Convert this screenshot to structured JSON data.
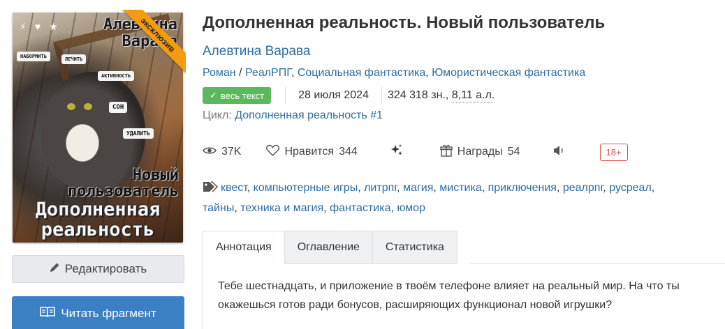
{
  "book": {
    "title": "Дополненная реальность. Новый пользователь",
    "author": "Алевтина Варава",
    "genres": [
      "Роман",
      "РеалРПГ",
      "Социальная фантастика",
      "Юмористическая фантастика"
    ],
    "status_badge": "весь текст",
    "date": "28 июля 2024",
    "size_chars": "324 318 зн.,",
    "size_al": "8,11 а.л.",
    "series_label": "Цикл:",
    "series_link": "Дополненная реальность #1"
  },
  "cover": {
    "author_text": "Алевтина\nВарава",
    "badge": "эксклюзив",
    "subtitle": "Новый\nпользователь",
    "title": "Дополненная\nреальность",
    "chips": [
      "НАБОРМИТЬ",
      "ЛЕЧИТЬ",
      "АКТИВНОСТЬ",
      "СОН",
      "УДАЛИТЬ"
    ]
  },
  "stats": {
    "views": "37K",
    "likes_label": "Нравится",
    "likes": "344",
    "awards_label": "Награды",
    "awards": "54",
    "age_rating": "18+"
  },
  "tags": [
    "квест",
    "компьютерные игры",
    "литрпг",
    "магия",
    "мистика",
    "приключения",
    "реалрпг",
    "русреал",
    "тайны",
    "техника и магия",
    "фантастика",
    "юмор"
  ],
  "tabs": [
    {
      "label": "Аннотация",
      "active": true
    },
    {
      "label": "Оглавление",
      "active": false
    },
    {
      "label": "Статистика",
      "active": false
    }
  ],
  "annotation": "Тебе шестнадцать, и приложение в твоём телефоне влияет на реальный мир. На что ты окажешься готов ради бонусов, расширяющих функционал новой игрушки?",
  "buttons": {
    "edit": "Редактировать",
    "read": "Читать фрагмент"
  },
  "icons": {
    "eye": "eye-icon",
    "heart": "heart-icon",
    "sparkle": "sparkle-icon",
    "gift": "gift-icon",
    "speaker": "speaker-icon",
    "tag": "tag-icon",
    "pencil": "pencil-icon",
    "book": "open-book-icon",
    "check": "check-icon"
  },
  "colors": {
    "link": "#2b6ca3",
    "success": "#5cb85c",
    "primary_button": "#3b7fc4",
    "age_badge": "#d9534f",
    "exclusive_ribbon": "#f39c12"
  }
}
